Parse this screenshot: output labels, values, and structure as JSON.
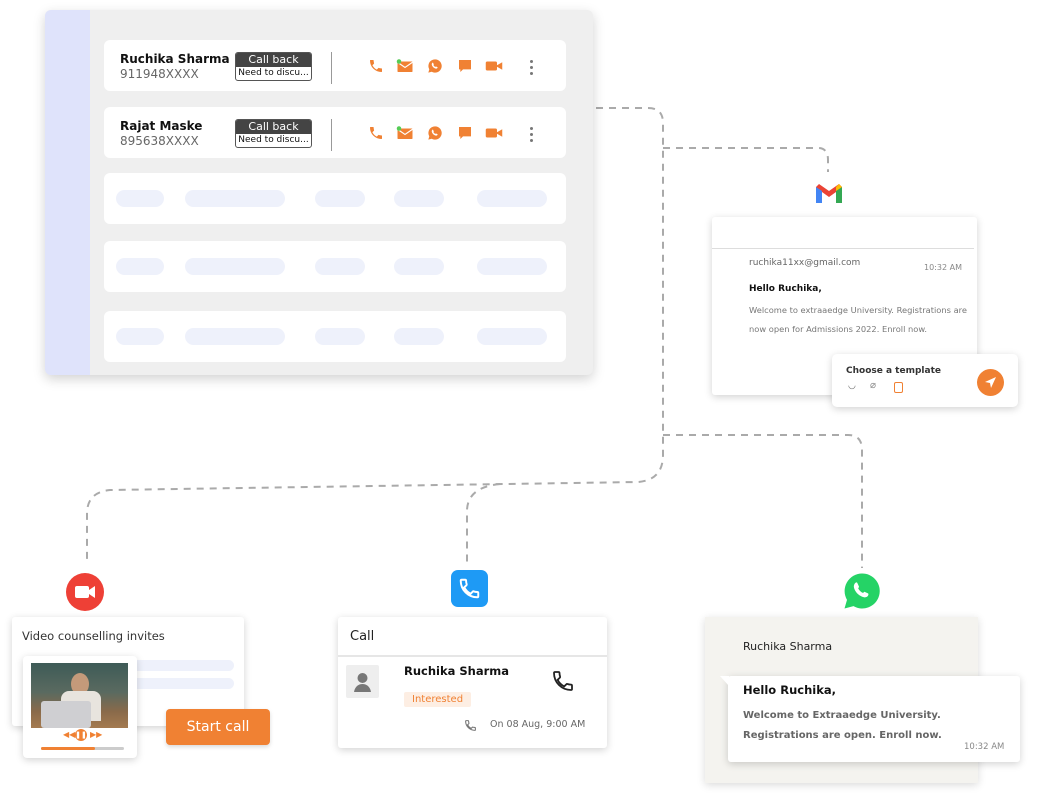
{
  "leads": [
    {
      "name": "Ruchika Sharma",
      "phone": "911948XXXX",
      "status": "Call back",
      "note": "Need to discu..."
    },
    {
      "name": "Rajat Maske",
      "phone": "895638XXXX",
      "status": "Call back",
      "note": "Need to discu..."
    }
  ],
  "row_actions": [
    "phone-icon",
    "email-icon",
    "whatsapp-icon",
    "chat-icon",
    "video-icon",
    "more-icon"
  ],
  "email": {
    "from": "ruchika11xx@gmail.com",
    "time": "10:32 AM",
    "greeting": "Hello Ruchika,",
    "body": "Welcome to extraaedge University. Registrations are now open for Admissions 2022. Enroll now.",
    "template_label": "Choose a template"
  },
  "video": {
    "title": "Video counselling invites",
    "start_label": "Start call",
    "progress": 0.65
  },
  "call": {
    "title": "Call",
    "name": "Ruchika Sharma",
    "status": "Interested",
    "schedule": "On 08 Aug, 9:00 AM"
  },
  "whatsapp": {
    "name": "Ruchika Sharma",
    "greeting": "Hello Ruchika,",
    "body": "Welcome to Extraaedge University. Registrations are  open. Enroll now.",
    "time": "10:32 AM"
  },
  "colors": {
    "accent": "#f08133",
    "stripe": "#dfe3fb",
    "video_red": "#ee4036",
    "phone_blue": "#1e9af5",
    "whatsapp_green": "#25d366"
  }
}
